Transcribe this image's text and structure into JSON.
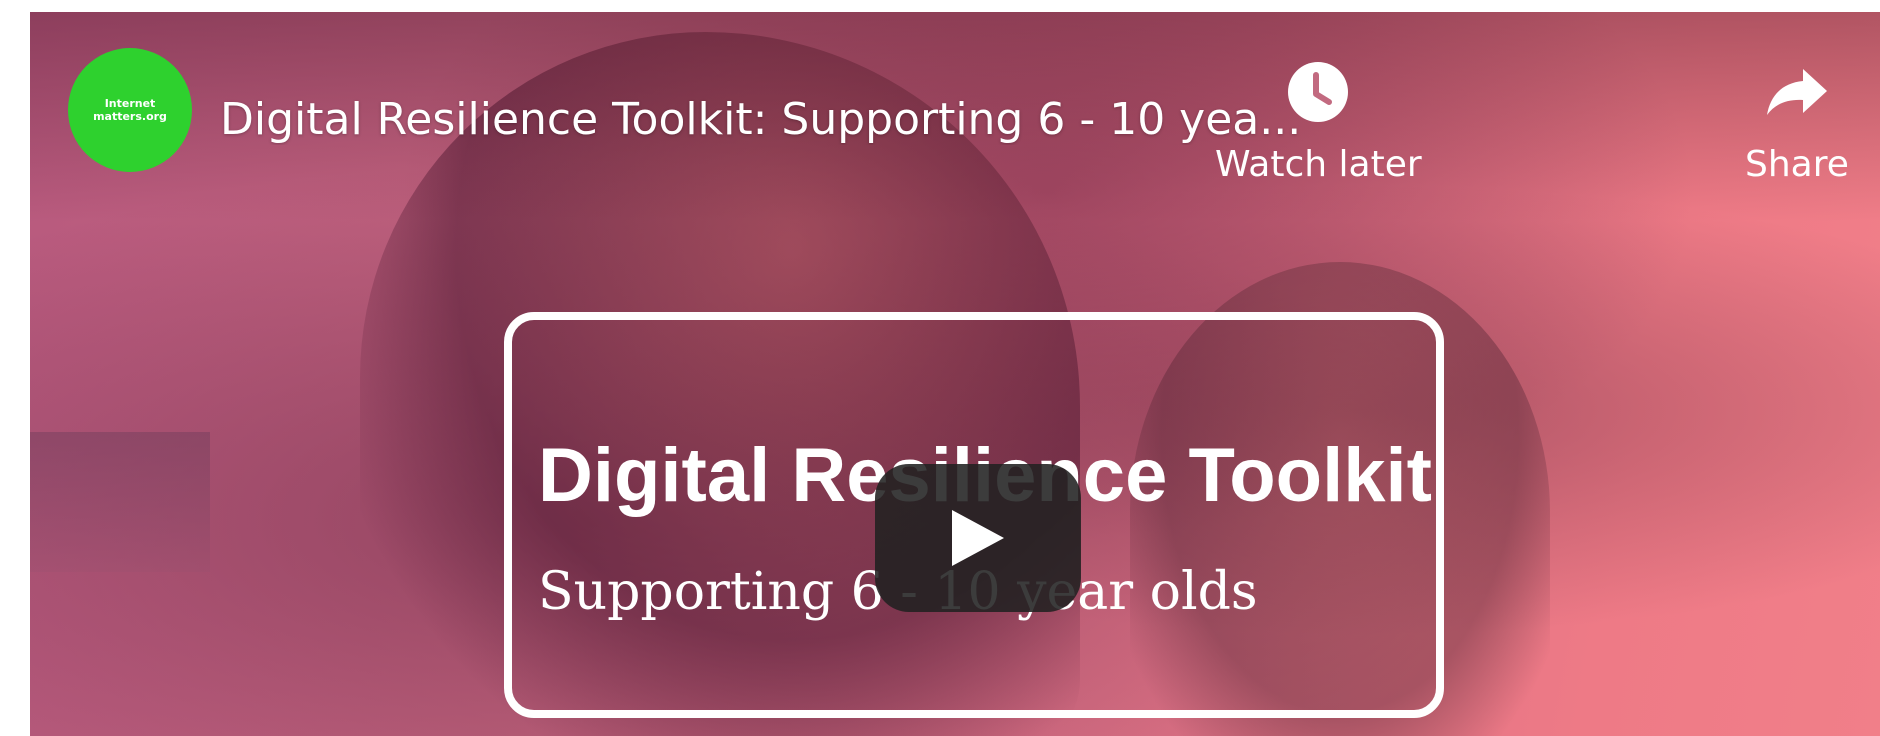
{
  "player": {
    "channel_logo_text_line1": "Internet",
    "channel_logo_text_line2": "matters.org",
    "title": "Digital Resilience Toolkit: Supporting 6 - 10 yea...",
    "actions": {
      "watch_later_label": "Watch later",
      "share_label": "Share"
    },
    "title_card": {
      "heading": "Digital Resilience Toolkit",
      "subheading": "Supporting 6 - 10 year olds"
    },
    "icons": {
      "watch_later": "clock-icon",
      "share": "share-arrow-icon",
      "play": "play-icon"
    },
    "colors": {
      "logo_green": "#2ed12e",
      "overlay_pink": "#e8788a",
      "play_button": "#212121"
    }
  }
}
